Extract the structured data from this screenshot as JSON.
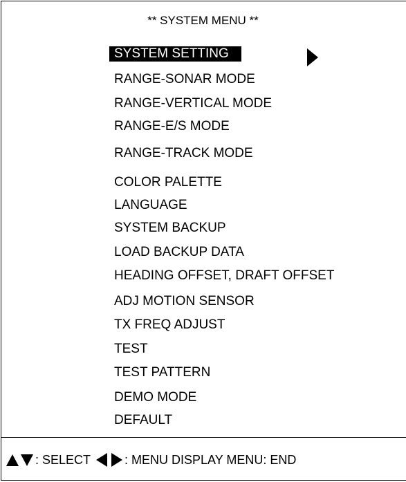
{
  "title": "** SYSTEM MENU **",
  "menu": {
    "items": [
      {
        "label": "SYSTEM SETTING",
        "selected": true
      },
      {
        "label": "RANGE-SONAR MODE"
      },
      {
        "label": "RANGE-VERTICAL MODE"
      },
      {
        "label": "RANGE-E/S MODE"
      },
      {
        "label": "RANGE-TRACK MODE"
      },
      {
        "label": "COLOR PALETTE"
      },
      {
        "label": "LANGUAGE"
      },
      {
        "label": "SYSTEM BACKUP"
      },
      {
        "label": "LOAD BACKUP DATA"
      },
      {
        "label": "HEADING OFFSET, DRAFT OFFSET"
      },
      {
        "label": "ADJ MOTION SENSOR"
      },
      {
        "label": "TX FREQ ADJUST"
      },
      {
        "label": "TEST"
      },
      {
        "label": "TEST PATTERN"
      },
      {
        "label": "DEMO MODE"
      },
      {
        "label": "DEFAULT"
      }
    ]
  },
  "footer": {
    "select_text": ": SELECT",
    "display_text": ": MENU DISPLAY  MENU: END"
  }
}
